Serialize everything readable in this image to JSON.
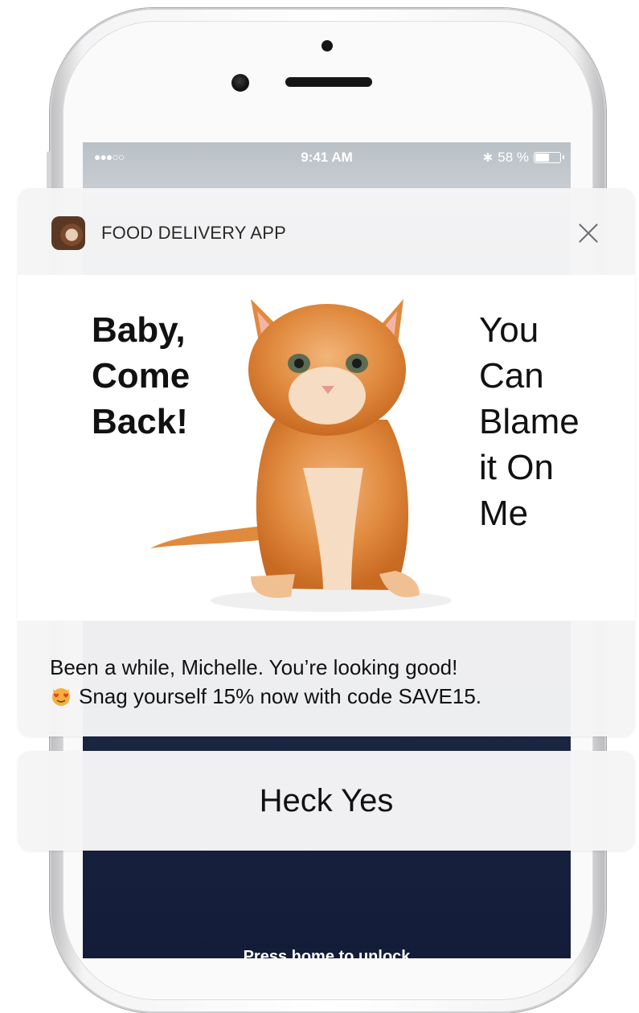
{
  "status_bar": {
    "signal": "●●●○○",
    "time": "9:41 AM",
    "bluetooth": "✱",
    "battery": "58 %",
    "battery_level": 0.58
  },
  "notification": {
    "app_name": "FOOD DELIVERY APP",
    "headline_left": [
      "Baby,",
      "Come",
      "Back!"
    ],
    "headline_right": [
      "You",
      "Can",
      "Blame",
      "it On",
      "Me"
    ],
    "message_line1": "Been a while, Michelle. You’re looking good!",
    "message_line2": "Snag yourself 15% now with code SAVE15.",
    "emoji": "smiling-cat-heart-eyes-icon"
  },
  "action": {
    "label": "Heck Yes"
  },
  "lock_screen": {
    "hint": "Press home to unlock"
  },
  "colors": {
    "card_bg": "#f5f5f6",
    "text": "#111111",
    "lock_bg": "#131c38"
  }
}
